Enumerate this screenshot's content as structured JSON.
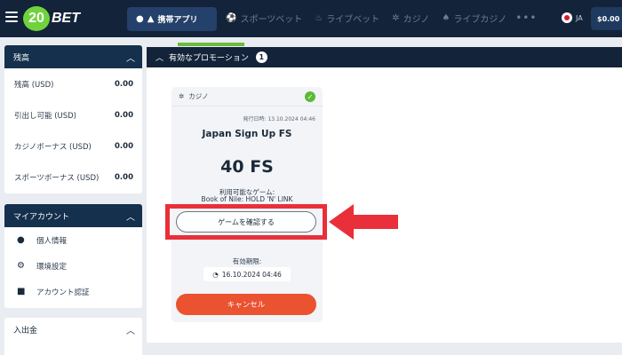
{
  "header": {
    "logo_number": "20",
    "logo_text": "BET",
    "app_button_label": "携帯アプリ",
    "nav": [
      {
        "icon": "soccer-ball-icon",
        "label": "スポーツベット"
      },
      {
        "icon": "flame-icon",
        "label": "ライブベット"
      },
      {
        "icon": "roulette-icon",
        "label": "カジノ"
      },
      {
        "icon": "cards-icon",
        "label": "ライブカジノ"
      }
    ],
    "more_label": "•••",
    "language": "JA",
    "balance": "$0.00"
  },
  "sidebar": {
    "balance_panel": {
      "title": "残高",
      "rows": [
        {
          "label": "残高 (USD)",
          "value": "0.00"
        },
        {
          "label": "引出し可能 (USD)",
          "value": "0.00"
        },
        {
          "label": "カジノボーナス (USD)",
          "value": "0.00"
        },
        {
          "label": "スポーツボーナス (USD)",
          "value": "0.00"
        }
      ]
    },
    "account_panel": {
      "title": "マイアカウント",
      "items": [
        {
          "icon": "user-icon",
          "label": "個人情報"
        },
        {
          "icon": "users-settings-icon",
          "label": "環境設定"
        },
        {
          "icon": "lock-icon",
          "label": "アカウント認証"
        }
      ]
    },
    "payments_panel": {
      "title": "入出金"
    }
  },
  "main": {
    "promo_header": "有効なプロモーション",
    "promo_count": "1",
    "card": {
      "category": "カジノ",
      "issue_date": "発行日時: 13.10.2024 04:46",
      "title": "Japan Sign Up FS",
      "amount": "40 FS",
      "available_label": "利用可能なゲーム:",
      "available_game": "Book of Nile: HOLD 'N' LINK",
      "confirm_button": "ゲームを確認する",
      "expiry_label": "有効期限:",
      "expiry_date": "16.10.2024 04:46",
      "cancel_button": "キャンセル"
    }
  },
  "colors": {
    "topbar": "#13233a",
    "accent_green": "#6cbb3c",
    "cancel_orange": "#ea5230",
    "annotation_red": "#e9303a"
  }
}
